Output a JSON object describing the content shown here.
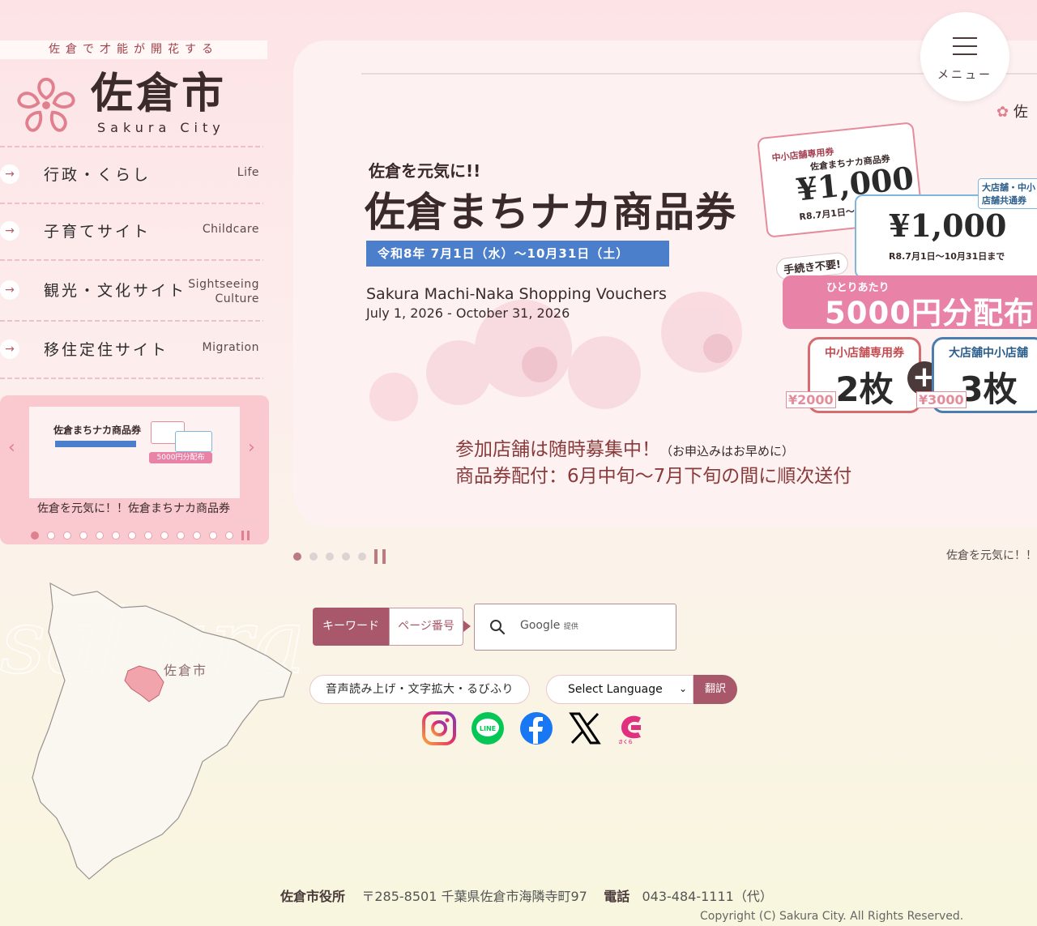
{
  "site": {
    "tagline": "佐倉で才能が開花する",
    "logo_title": "佐倉市",
    "logo_subtitle": "Sakura City"
  },
  "nav": [
    {
      "label_jp": "行政・くらし",
      "label_en": "Life"
    },
    {
      "label_jp": "子育てサイト",
      "label_en": "Childcare"
    },
    {
      "label_jp": "観光・文化サイト",
      "label_en": "Sightseeing Culture"
    },
    {
      "label_jp": "移住定住サイト",
      "label_en": "Migration"
    }
  ],
  "mini_carousel": {
    "caption": "佐倉を元気に！！佐倉まちナカ商品券",
    "slide_title": "佐倉まちナカ商品券",
    "slide_sub": "5000円分配布",
    "dots_count": 13,
    "active_dot": 0,
    "prev_icon": "chevron-left-icon",
    "next_icon": "chevron-right-icon"
  },
  "map": {
    "label": "佐倉市",
    "script_text": "sakura"
  },
  "hero": {
    "subtitle": "佐倉を元気に!!",
    "title": "佐倉まちナカ商品券",
    "date_bar": "令和8年 7月1日（水）～10月31日（土）",
    "en_title": "Sakura Machi-Naka Shopping Vouchers",
    "en_dates": "July 1, 2026 - October 31, 2026",
    "voucher_amount": "¥1,000",
    "voucher_label_left": "中小店舗専用券",
    "voucher_label_right": "大店舗・中小店舗共通券",
    "voucher_name": "佐倉まちナカ商品券",
    "voucher_period": "R8.7月1日～10月31日まで",
    "badge_nofee": "手続き不要!",
    "banner_small": "ひとりあたり",
    "banner_big": "5000円分配布",
    "ticket1_head": "中小店舗専用券",
    "ticket1_count": "2枚",
    "ticket1_price": "¥2000",
    "ticket2_head": "大店舗中小店舗",
    "ticket2_count": "3枚",
    "ticket2_price": "¥3000",
    "notice1": "参加店舗は随時募集中！",
    "notice1_small": "（お申込みはお早めに）",
    "notice2": "商品券配付：6月中旬～7月下旬の間に順次送付",
    "corner_text": "佐",
    "dots_count": 5,
    "active_dot": 0,
    "ticker": "佐倉を元気に！！"
  },
  "menu": {
    "label": "メニュー"
  },
  "search": {
    "tab_keyword": "キーワード",
    "tab_page": "ページ番号",
    "google_label": "Google",
    "google_provided": "提供"
  },
  "tools": {
    "accessibility_label": "音声読み上げ・文字拡大・るびふり",
    "language_select": "Select Language",
    "translate_label": "翻訳"
  },
  "social": [
    {
      "icon": "instagram-icon",
      "color": "#e1306c"
    },
    {
      "icon": "line-icon",
      "color": "#06c755"
    },
    {
      "icon": "facebook-icon",
      "color": "#1877f2"
    },
    {
      "icon": "x-icon",
      "color": "#000000"
    },
    {
      "icon": "sakura-app-icon",
      "color": "#e0307f",
      "caption": "さくら"
    }
  ],
  "footer": {
    "office": "佐倉市役所",
    "address": "〒285-8501 千葉県佐倉市海隣寺町97",
    "phone_label": "電話",
    "phone": "043-484-1111（代）",
    "copyright": "Copyright (C) Sakura City. All Rights Reserved."
  },
  "colors": {
    "accent": "#a8586a",
    "pink": "#e882a6",
    "blue": "#4b7ecb"
  }
}
